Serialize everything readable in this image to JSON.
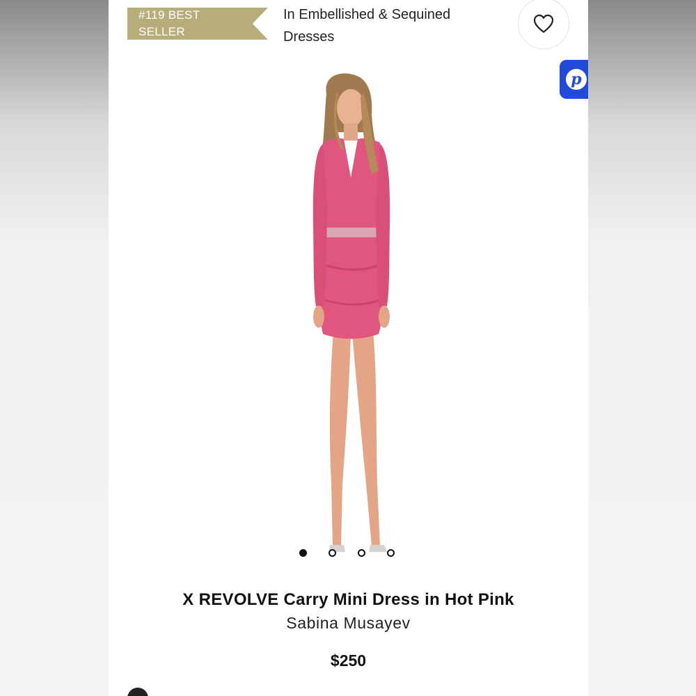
{
  "badge": {
    "line1": "#119 BEST",
    "line2": "SELLER",
    "color": "#b7ad7a"
  },
  "category": {
    "line1": "In Embellished & Sequined",
    "line2": "Dresses"
  },
  "wishlist": {
    "icon": "heart-icon"
  },
  "side_button": {
    "icon": "p-logo-icon",
    "glyph": "p",
    "color": "#1f4bd8"
  },
  "gallery": {
    "slide_count": 4,
    "active_index": 0,
    "dress_color": "#e0567f"
  },
  "product": {
    "title": "X REVOLVE Carry Mini Dress in Hot Pink",
    "brand": "Sabina Musayev",
    "price": "$250"
  }
}
